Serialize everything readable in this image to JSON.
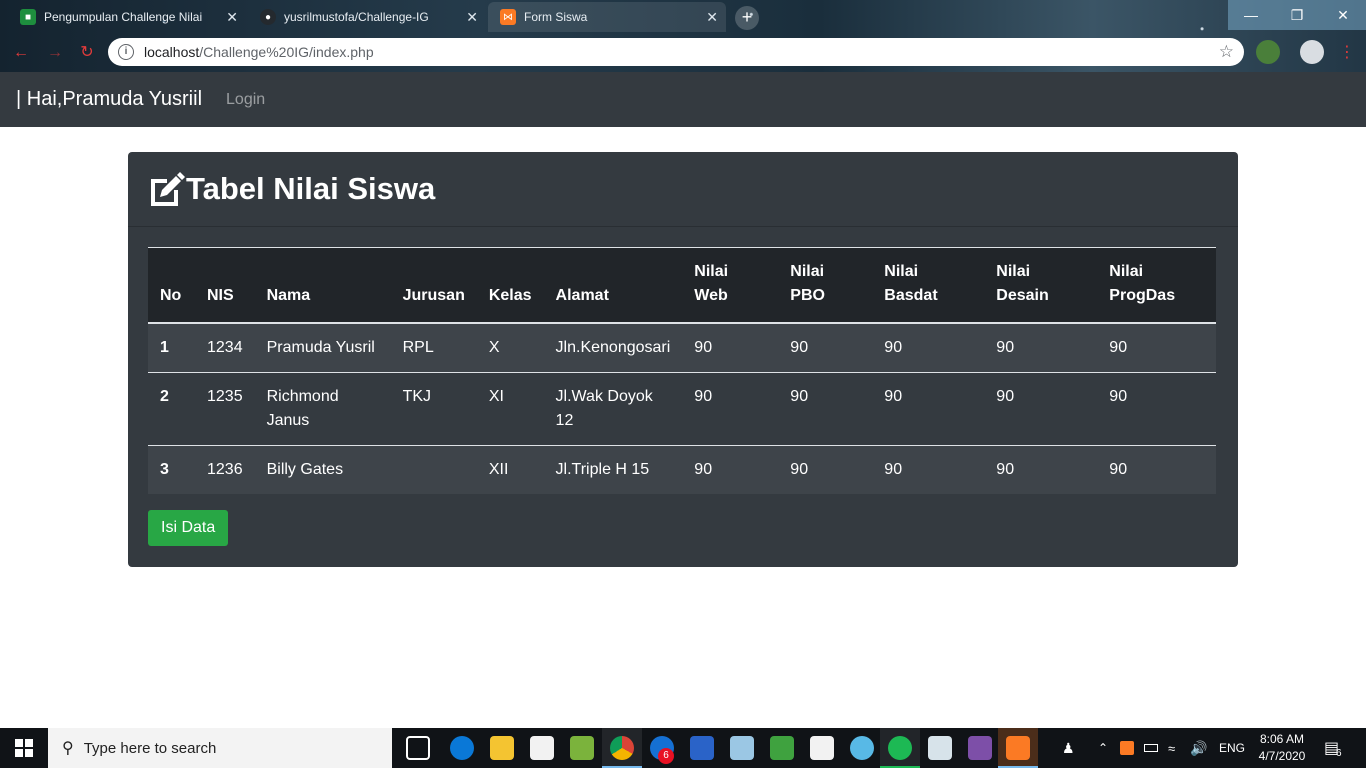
{
  "browser": {
    "tabs": [
      {
        "title": "Pengumpulan Challenge Nilai",
        "icon": "classroom-icon"
      },
      {
        "title": "yusrilmustofa/Challenge-IG",
        "icon": "github-icon"
      },
      {
        "title": "Form Siswa",
        "icon": "xampp-icon"
      }
    ],
    "url_host": "localhost",
    "url_path": "/Challenge%20IG/index.php"
  },
  "navbar": {
    "brand": "| Hai,Pramuda Yusriil",
    "login": "Login"
  },
  "card": {
    "title": "Tabel Nilai Siswa",
    "icon": "edit-icon"
  },
  "table": {
    "headers": {
      "no": "No",
      "nis": "NIS",
      "nama": "Nama",
      "jurusan": "Jurusan",
      "kelas": "Kelas",
      "alamat": "Alamat",
      "web_1": "Nilai",
      "web_2": "Web",
      "pbo_1": "Nilai",
      "pbo_2": "PBO",
      "basdat_1": "Nilai",
      "basdat_2": "Basdat",
      "desain_1": "Nilai",
      "desain_2": "Desain",
      "progdas_1": "Nilai",
      "progdas_2": "ProgDas"
    },
    "rows": [
      {
        "no": "1",
        "nis": "1234",
        "nama": "Pramuda Yusril",
        "jurusan": "RPL",
        "kelas": "X",
        "alamat": "Jln.Kenongosari",
        "web": "90",
        "pbo": "90",
        "basdat": "90",
        "desain": "90",
        "progdas": "90"
      },
      {
        "no": "2",
        "nis": "1235",
        "nama": "Richmond Janus",
        "jurusan": "TKJ",
        "kelas": "XI",
        "alamat": "Jl.Wak Doyok 12",
        "web": "90",
        "pbo": "90",
        "basdat": "90",
        "desain": "90",
        "progdas": "90"
      },
      {
        "no": "3",
        "nis": "1236",
        "nama": "Billy Gates",
        "jurusan": "",
        "kelas": "XII",
        "alamat": "Jl.Triple H 15",
        "web": "90",
        "pbo": "90",
        "basdat": "90",
        "desain": "90",
        "progdas": "90"
      }
    ]
  },
  "buttons": {
    "isi_data": "Isi Data"
  },
  "taskbar": {
    "search_placeholder": "Type here to search",
    "language": "ENG",
    "time": "8:06 AM",
    "date": "4/7/2020",
    "notification_count": "6",
    "chrome_badge": "6"
  },
  "colors": {
    "navbar": "#343a40",
    "table_head": "#212529",
    "success": "#28a745"
  }
}
